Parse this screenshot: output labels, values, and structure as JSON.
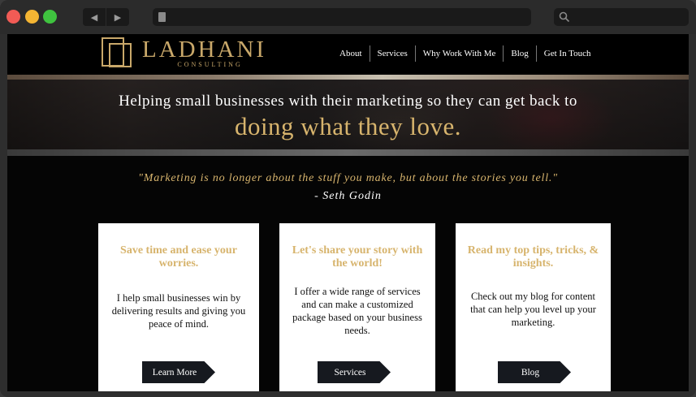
{
  "site": {
    "logo_name": "LADHANI",
    "logo_sub": "CONSULTING",
    "accent_color": "#d7b46d"
  },
  "nav": {
    "items": [
      "About",
      "Services",
      "Why Work With Me",
      "Blog",
      "Get In Touch"
    ]
  },
  "hero": {
    "line1": "Helping small businesses with their marketing so they can get back to",
    "line2": "doing what they love."
  },
  "quote": {
    "text": "\"Marketing is no longer about the stuff you make, but about the stories you tell.\"",
    "author": "- Seth Godin"
  },
  "cards": [
    {
      "title": "Save time and ease your worries.",
      "body": "I help small businesses win by delivering results and giving you peace of mind.",
      "button": "Learn More"
    },
    {
      "title": "Let's share your story with the world!",
      "body": "I offer a wide range of services and can make a customized package based on your business needs.",
      "button": "Services"
    },
    {
      "title": "Read my top tips, tricks, & insights.",
      "body": "Check out my blog for content that can help you level up your marketing.",
      "button": "Blog"
    }
  ],
  "chrome": {
    "back_icon": "◀",
    "forward_icon": "▶"
  }
}
